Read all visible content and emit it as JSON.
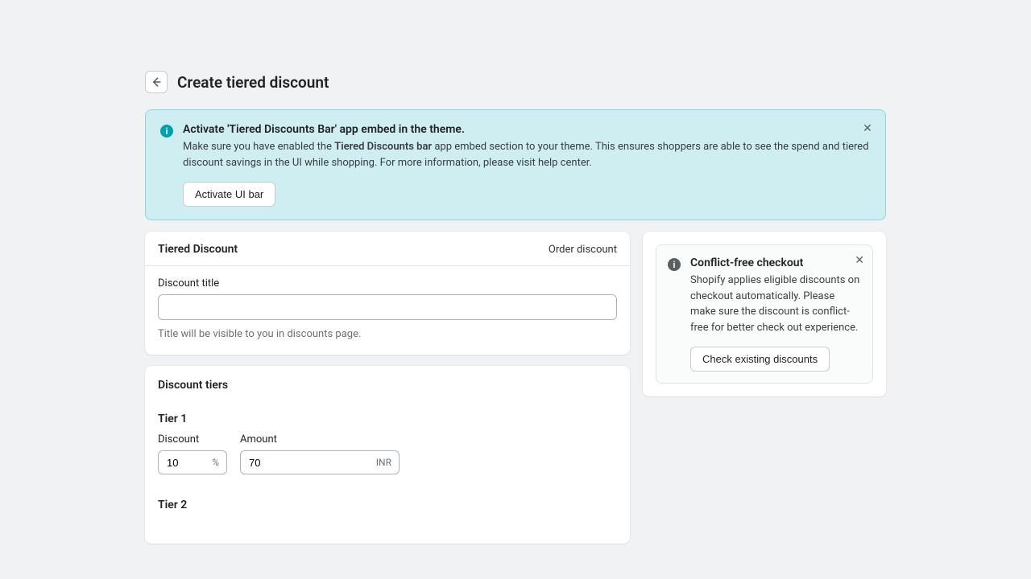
{
  "header": {
    "title": "Create tiered discount"
  },
  "banner": {
    "title": "Activate 'Tiered Discounts Bar' app embed in the theme.",
    "text_pre": "Make sure you have enabled the ",
    "text_bold": "Tiered Discounts bar",
    "text_post": " app embed section to your theme. This ensures shoppers are able to see the spend and tiered discount savings in the UI while shopping. For more information, please visit help center.",
    "button": "Activate UI bar"
  },
  "tiered_card": {
    "heading": "Tiered Discount",
    "type": "Order discount",
    "field_label": "Discount title",
    "help": "Title will be visible to you in discounts page."
  },
  "tiers": {
    "heading": "Discount tiers",
    "discount_label": "Discount",
    "amount_label": "Amount",
    "percent_suffix": "%",
    "currency_suffix": "INR",
    "items": [
      {
        "label": "Tier 1",
        "discount": "10",
        "amount": "70"
      },
      {
        "label": "Tier 2",
        "discount": "",
        "amount": ""
      }
    ]
  },
  "side": {
    "title": "Conflict-free checkout",
    "text": "Shopify applies eligible discounts on checkout automatically. Please make sure the discount is conflict-free for better check out experience.",
    "button": "Check existing discounts"
  }
}
